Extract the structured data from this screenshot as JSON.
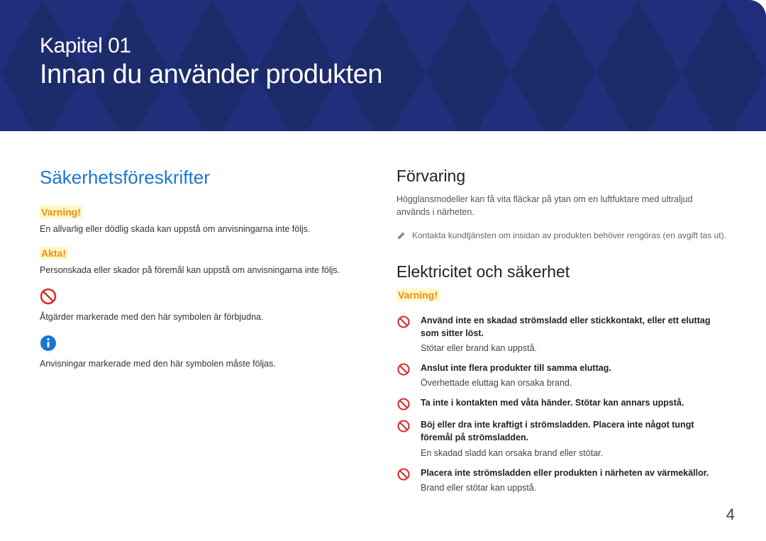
{
  "banner": {
    "chapter_label": "Kapitel 01",
    "chapter_title": "Innan du använder produkten"
  },
  "left": {
    "heading": "Säkerhetsföreskrifter",
    "warning_tag": "Varning!",
    "warning_text": "En allvarlig eller dödlig skada kan uppstå om anvisningarna inte följs.",
    "caution_tag": "Akta!",
    "caution_text": "Personskada eller skador på föremål kan uppstå om anvisningarna inte följs.",
    "prohibit_text": "Åtgärder markerade med den här symbolen är förbjudna.",
    "mandatory_text": "Anvisningar markerade med den här symbolen måste följas."
  },
  "right": {
    "storage_heading": "Förvaring",
    "storage_text": "Högglansmodeller kan få vita fläckar på ytan om en luftfuktare med ultraljud används i närheten.",
    "storage_note": "Kontakta kundtjänsten om insidan av produkten behöver rengöras (en avgift tas ut).",
    "elec_heading": "Elektricitet och säkerhet",
    "elec_warning_tag": "Varning!",
    "items": [
      {
        "bold": "Använd inte en skadad strömsladd eller stickkontakt, eller ett eluttag som sitter löst.",
        "plain": "Stötar eller brand kan uppstå."
      },
      {
        "bold": "Anslut inte flera produkter till samma eluttag.",
        "plain": "Överhettade eluttag kan orsaka brand."
      },
      {
        "bold": "Ta inte i kontakten med våta händer. Stötar kan annars uppstå.",
        "plain": ""
      },
      {
        "bold": "Böj eller dra inte kraftigt i strömsladden. Placera inte något tungt föremål på strömsladden.",
        "plain": "En skadad sladd kan orsaka brand eller stötar."
      },
      {
        "bold": "Placera inte strömsladden eller produkten i närheten av värmekällor.",
        "plain": "Brand eller stötar kan uppstå."
      }
    ]
  },
  "page_number": "4"
}
